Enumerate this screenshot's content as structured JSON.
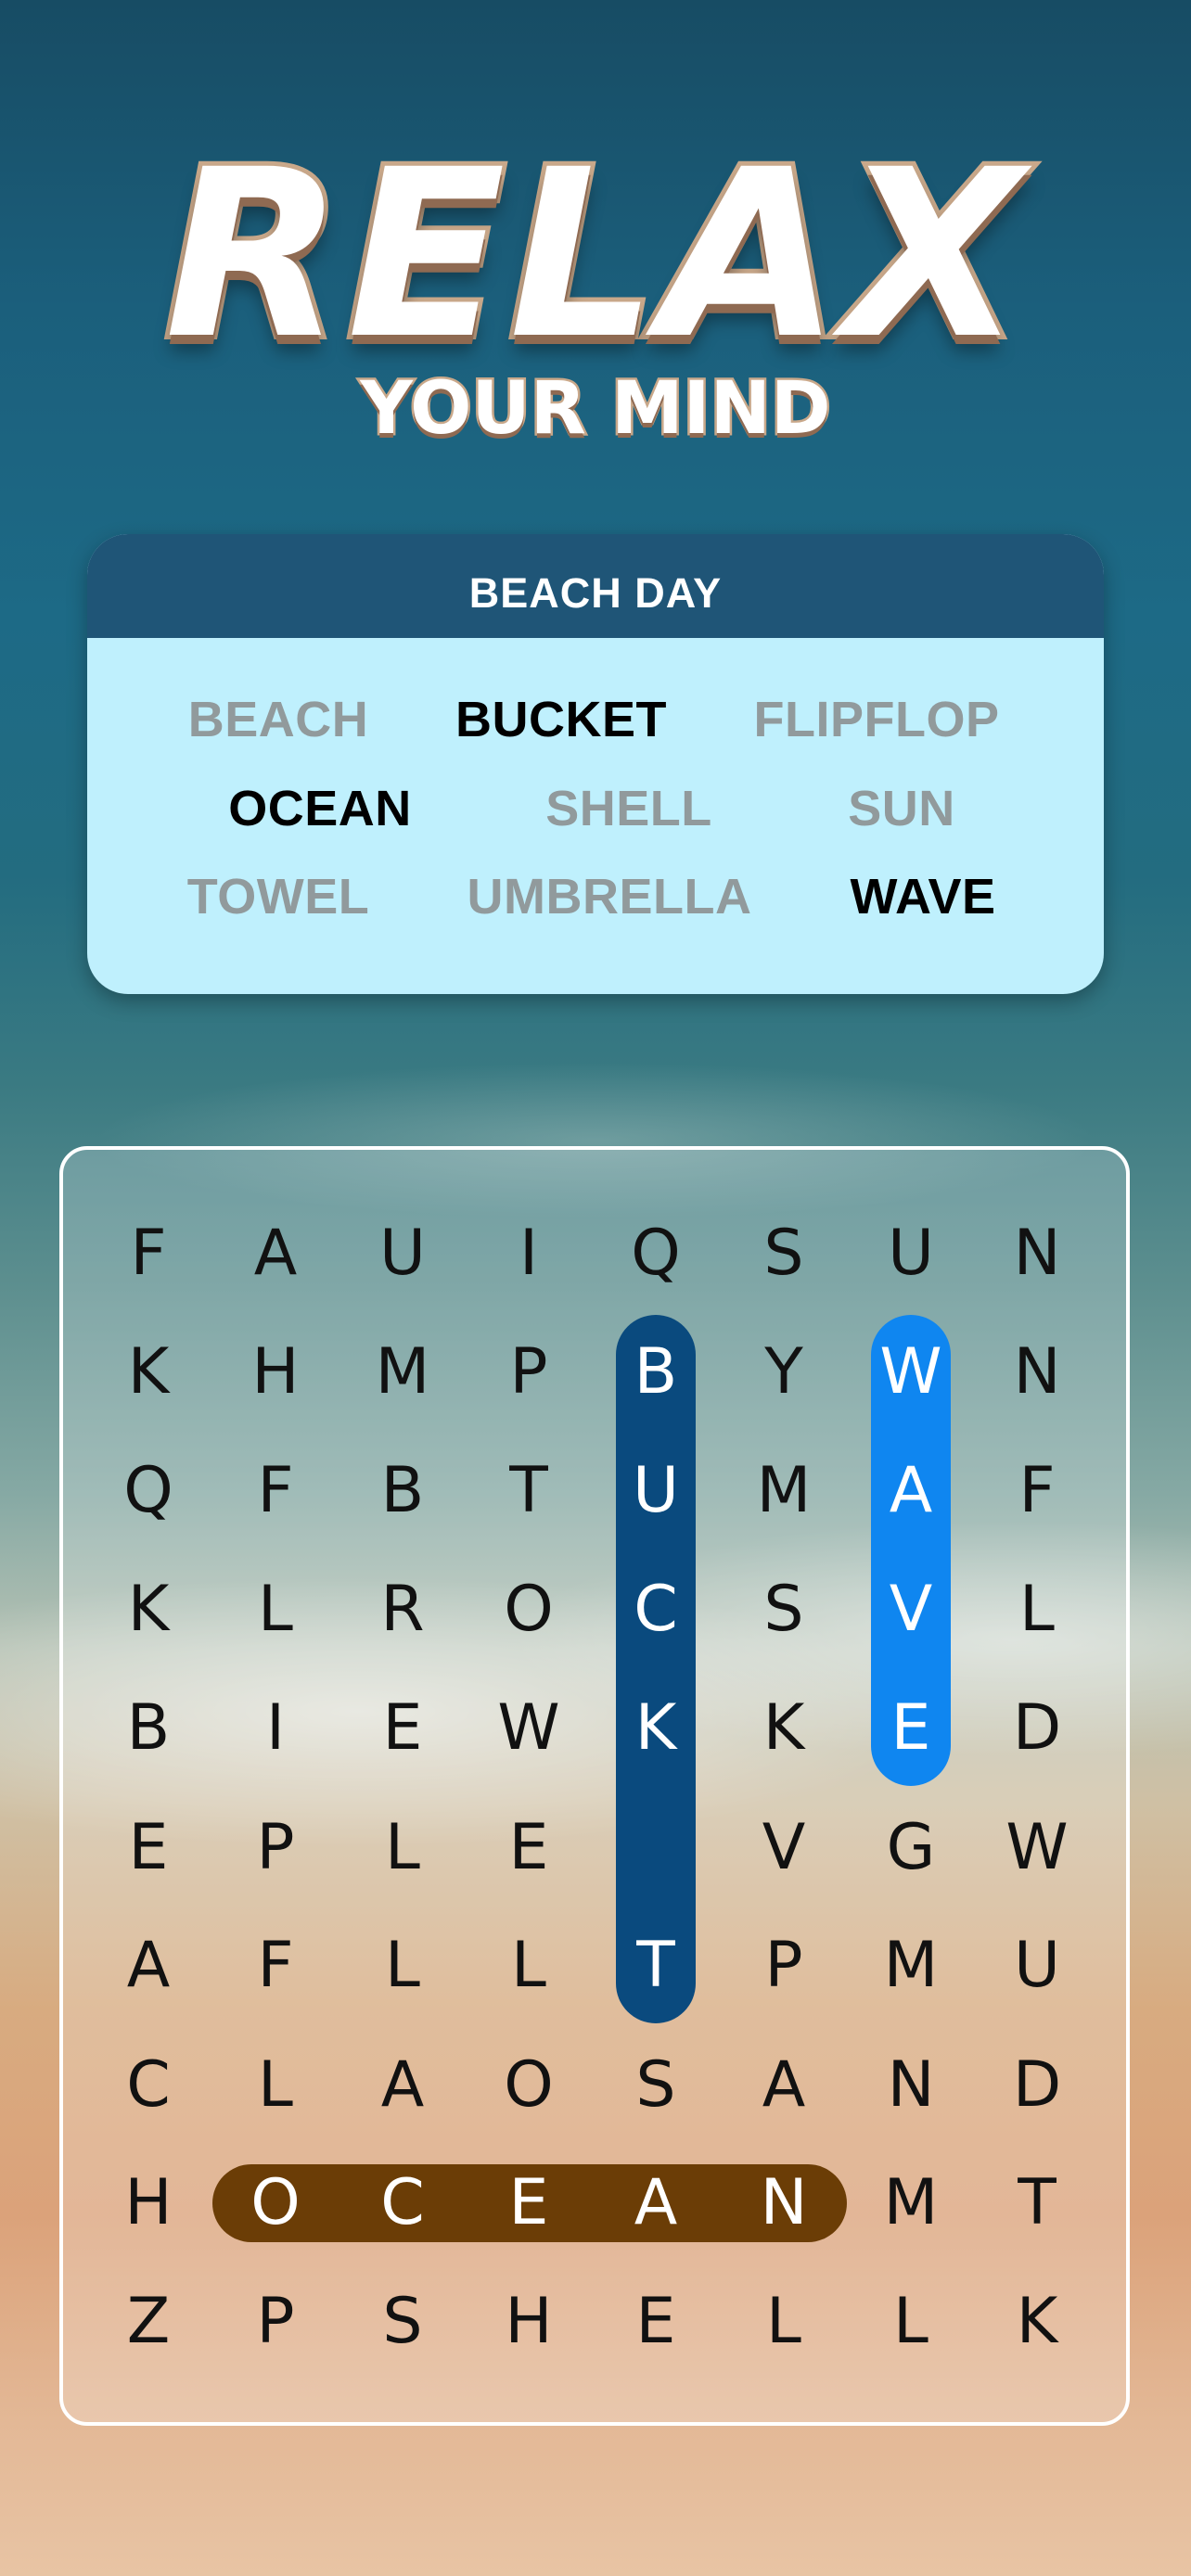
{
  "header": {
    "title": "RELAX",
    "subtitle": "YOUR MIND"
  },
  "word_panel": {
    "title": "BEACH DAY",
    "words": [
      {
        "text": "BEACH",
        "found": true
      },
      {
        "text": "BUCKET",
        "found": false
      },
      {
        "text": "FLIPFLOP",
        "found": true
      },
      {
        "text": "OCEAN",
        "found": false
      },
      {
        "text": "SHELL",
        "found": true
      },
      {
        "text": "SUN",
        "found": true
      },
      {
        "text": "TOWEL",
        "found": true
      },
      {
        "text": "UMBRELLA",
        "found": true
      },
      {
        "text": "WAVE",
        "found": false
      }
    ]
  },
  "grid": {
    "rows": [
      "FAUIQSUN",
      "KHMPBYWN",
      "QFBTUMAF",
      "KLROCSVL",
      "BIEWKKED",
      "EPLEVGW",
      "AFLLTPMU",
      "CLAOSAND",
      "HOCEANMT",
      "ZPSHELLK"
    ],
    "highlights": [
      {
        "word": "BUCKET",
        "direction": "vertical",
        "col": 4,
        "row_start": 1,
        "row_end": 6,
        "color": "#0a4a7e"
      },
      {
        "word": "WAVE",
        "direction": "vertical",
        "col": 6,
        "row_start": 1,
        "row_end": 4,
        "color": "#0f86f0"
      },
      {
        "word": "OCEAN",
        "direction": "horizontal",
        "row": 8,
        "col_start": 1,
        "col_end": 5,
        "color": "#6b3d06"
      }
    ]
  },
  "colors": {
    "panel_header": "#1f5577",
    "panel_body": "#bff0fd",
    "found_word": "#919a9c",
    "pending_word": "#000000"
  }
}
